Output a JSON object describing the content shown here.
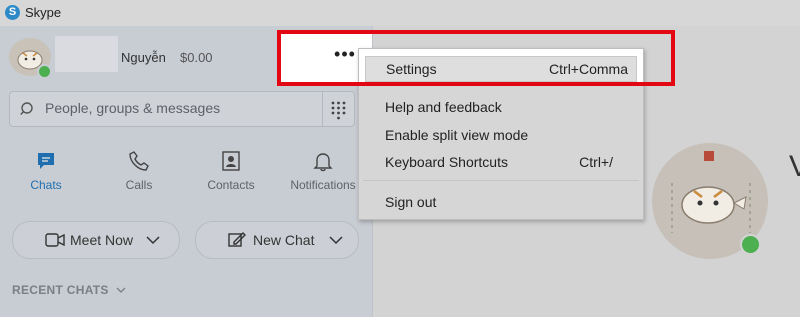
{
  "app": {
    "title": "Skype",
    "logo_letter": "S"
  },
  "profile": {
    "name": "Nguyễn",
    "balance": "$0.00"
  },
  "search": {
    "placeholder": "People, groups & messages"
  },
  "nav": [
    {
      "label": "Chats",
      "icon": "chat-icon",
      "active": true
    },
    {
      "label": "Calls",
      "icon": "phone-icon",
      "active": false
    },
    {
      "label": "Contacts",
      "icon": "contacts-icon",
      "active": false
    },
    {
      "label": "Notifications",
      "icon": "bell-icon",
      "active": false
    }
  ],
  "actions": {
    "meet_now": {
      "label": "Meet Now",
      "icon": "video-camera-icon"
    },
    "new_chat": {
      "label": "New Chat",
      "icon": "compose-icon"
    }
  },
  "recent": {
    "header": "RECENT CHATS"
  },
  "more_button": {
    "label": "•••"
  },
  "menu": {
    "items": [
      {
        "label": "Settings",
        "shortcut": "Ctrl+Comma",
        "selected": true
      },
      {
        "label": "Help and feedback",
        "shortcut": ""
      },
      {
        "label": "Enable split view mode",
        "shortcut": ""
      },
      {
        "label": "Keyboard Shortcuts",
        "shortcut": "Ctrl+/"
      },
      {
        "label": "Sign out",
        "shortcut": ""
      }
    ]
  },
  "welcome": {
    "partial_text": "V"
  },
  "colors": {
    "accent": "#1f6fb0",
    "highlight": "#e30613",
    "presence": "#4caf50"
  }
}
